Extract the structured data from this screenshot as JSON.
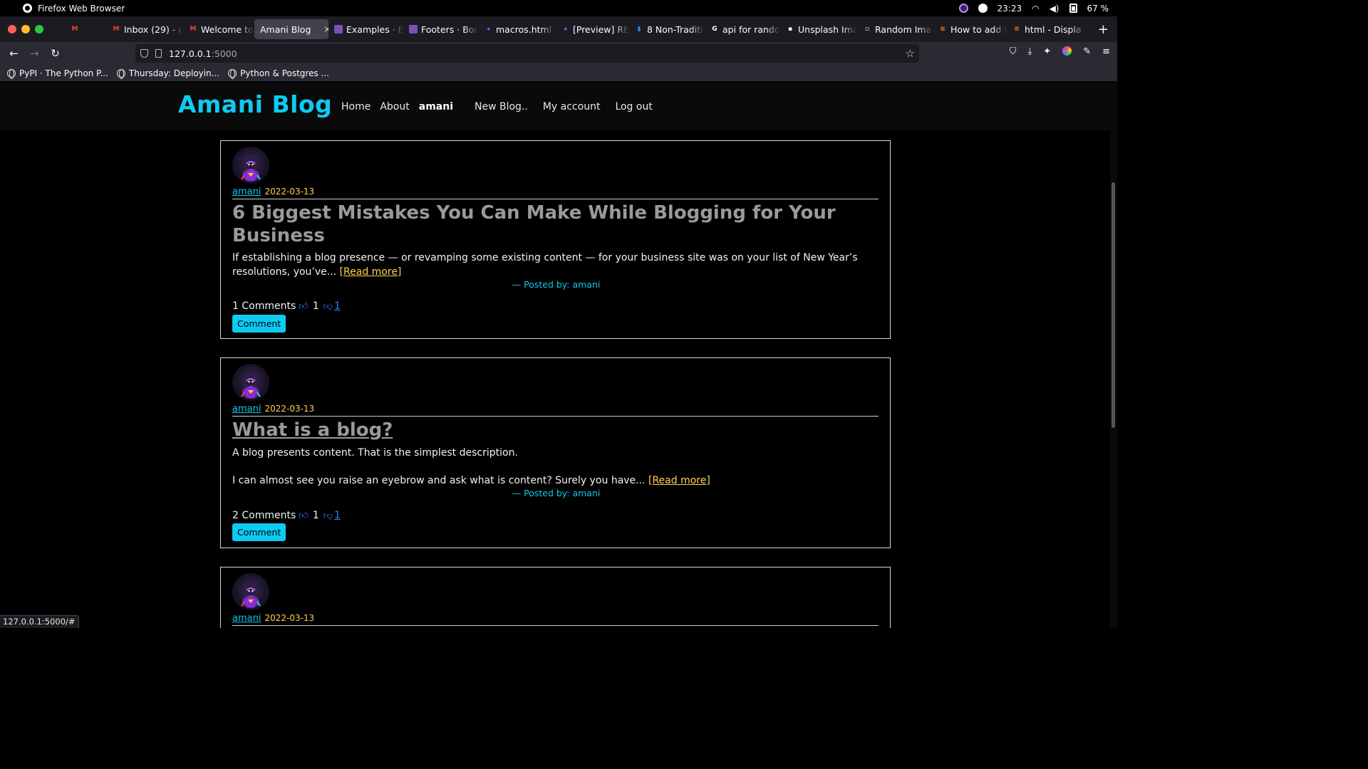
{
  "os": {
    "app_name": "Firefox Web Browser",
    "time": "23:23",
    "battery": "67 %"
  },
  "tabs": [
    {
      "label": "",
      "color": "#ea4335",
      "glyph": "M",
      "pinned": true
    },
    {
      "label": "",
      "color": "#555555",
      "glyph": "",
      "pinned": true
    },
    {
      "label": "Inbox (29) - c",
      "color": "#ea4335",
      "glyph": "M"
    },
    {
      "label": "Welcome to I",
      "color": "#ea4335",
      "glyph": "M"
    },
    {
      "label": "Amani Blog",
      "active": true
    },
    {
      "label": "Examples · B",
      "color": "#7952b3",
      "glyph": "B"
    },
    {
      "label": "Footers · Boo",
      "color": "#7952b3",
      "glyph": "B"
    },
    {
      "label": "macros.html",
      "color": "#3b82f6",
      "glyph": "◂"
    },
    {
      "label": "[Preview] RE",
      "color": "#3b82f6",
      "glyph": "◂"
    },
    {
      "label": "8 Non-Traditi",
      "color": "#2d7ff9",
      "glyph": "▮"
    },
    {
      "label": "api for rando",
      "color": "#ffffff",
      "glyph": "G"
    },
    {
      "label": "Unsplash Ima",
      "color": "#ffffff",
      "glyph": "▪"
    },
    {
      "label": "Random Ima",
      "color": "#ffffff",
      "glyph": "▫"
    },
    {
      "label": "How to add t",
      "color": "#f48024",
      "glyph": "≡"
    },
    {
      "label": "html - Displa",
      "color": "#f48024",
      "glyph": "≡"
    }
  ],
  "tab_close": "×",
  "new_tab": "+",
  "address": {
    "host": "127.0.0.1",
    "port": ":5000"
  },
  "bookmarks": [
    "PyPI · The Python P...",
    "Thursday: Deployin...",
    "Python & Postgres ..."
  ],
  "site": {
    "brand": "Amani Blog",
    "nav": [
      "Home",
      "About"
    ],
    "user": "amani",
    "nav_right": [
      "New Blog..",
      "My account",
      "Log out"
    ]
  },
  "posts": [
    {
      "author": "amani",
      "date": "2022-03-13",
      "title": "6 Biggest Mistakes You Can Make While Blogging for Your Business",
      "excerpt": "If establishing a blog presence — or revamping some existing content — for your business site was on your list of New Year’s resolutions, you’ve...",
      "read_more": "[Read more]",
      "posted_by": "—  Posted by: amani",
      "comments": "1 Comments",
      "likes": "1",
      "dislikes": "1",
      "comment_button": "Comment"
    },
    {
      "author": "amani",
      "date": "2022-03-13",
      "title": "What is a blog?",
      "excerpt_line1": "A blog presents content. That is the simplest description.",
      "excerpt_line2": "I can almost see you raise an eyebrow and ask what is content? Surely you have...",
      "read_more": "[Read more]",
      "posted_by": "—  Posted by: amani",
      "comments": "2 Comments",
      "likes": "1",
      "dislikes": "1",
      "comment_button": "Comment"
    },
    {
      "author": "amani",
      "date": "2022-03-13"
    }
  ],
  "status_url": "127.0.0.1:5000/#"
}
